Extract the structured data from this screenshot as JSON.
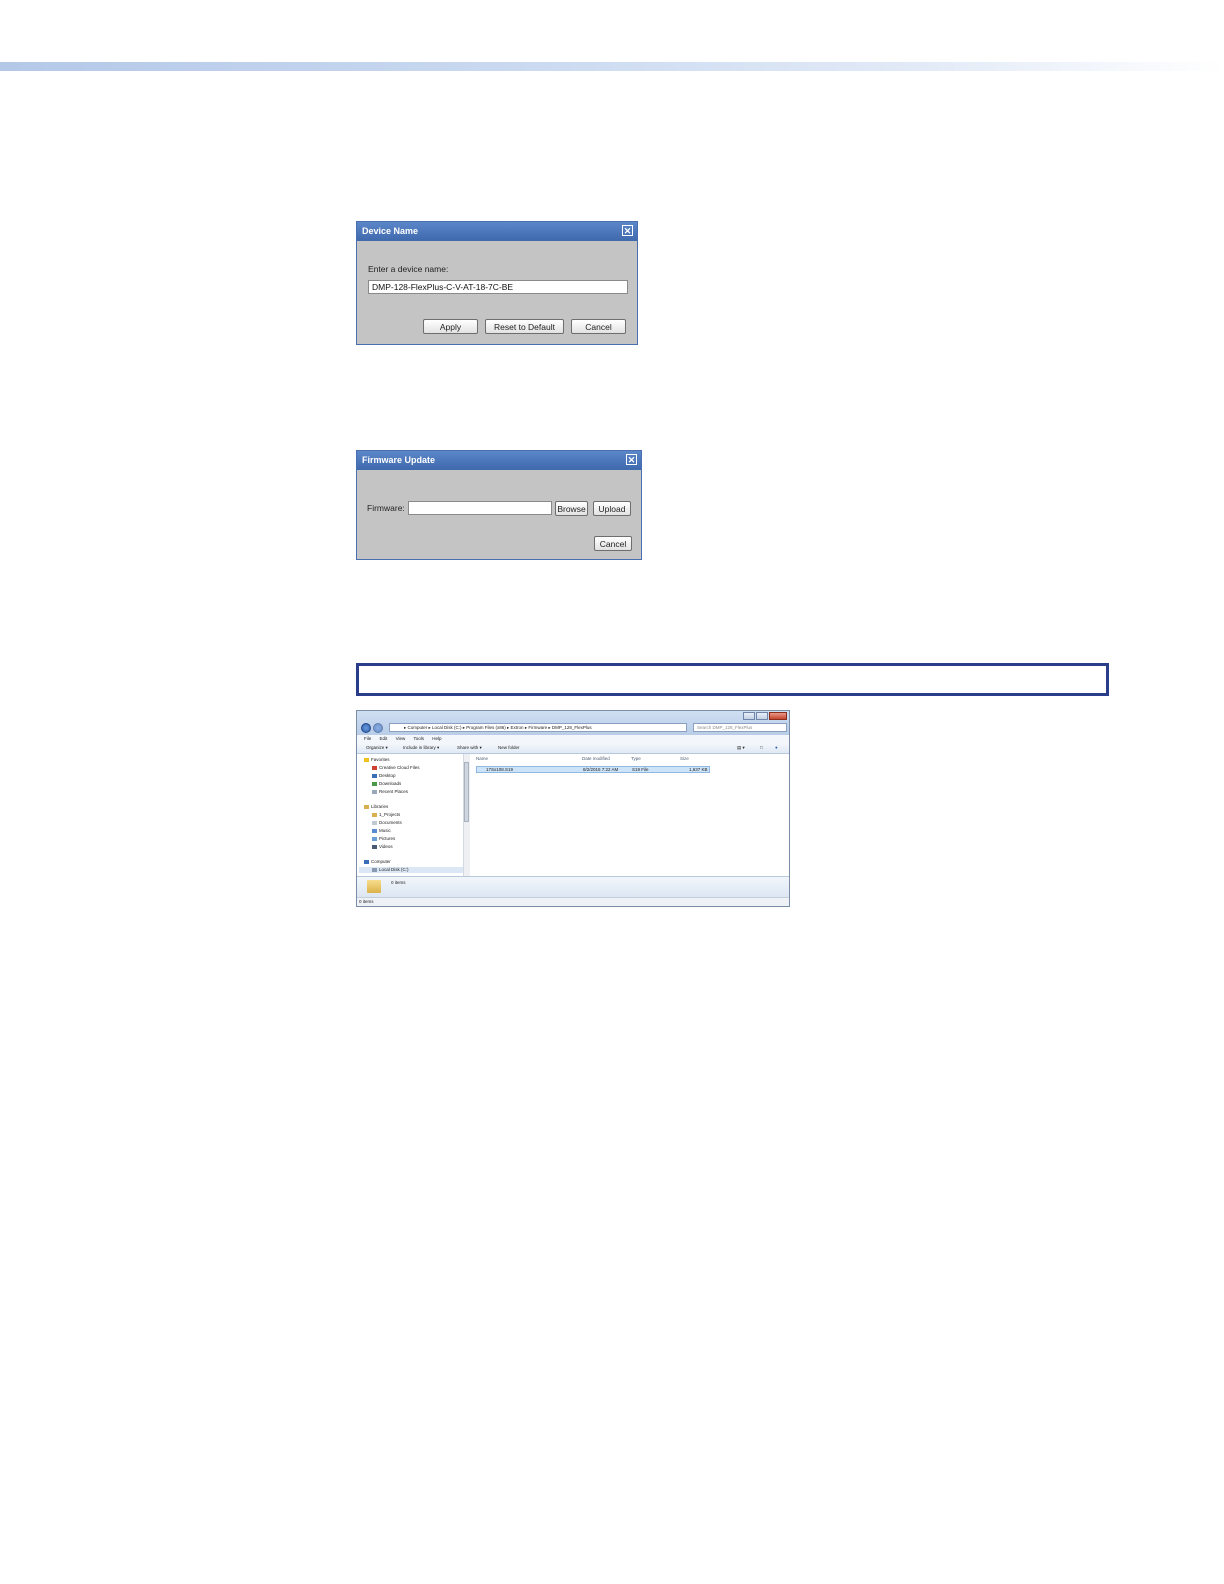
{
  "device_name_dialog": {
    "title": "Device Name",
    "prompt": "Enter a device name:",
    "value": "DMP-128-FlexPlus-C-V-AT-18-7C-BE",
    "apply_label": "Apply",
    "reset_label": "Reset to Default",
    "cancel_label": "Cancel",
    "close_glyph": "✕"
  },
  "firmware_dialog": {
    "title": "Firmware Update",
    "firmware_label": "Firmware:",
    "firmware_value": "",
    "browse_label": "Browse",
    "upload_label": "Upload",
    "cancel_label": "Cancel",
    "close_glyph": "✕"
  },
  "explorer": {
    "address": "▸ Computer ▸ Local Disk (C:) ▸ Program Files (x86) ▸ Extron ▸ Firmware ▸ DMP_128_FlexPlus",
    "search_placeholder": "Search DMP_128_FlexPlus",
    "menu": [
      "File",
      "Edit",
      "View",
      "Tools",
      "Help"
    ],
    "toolbar": {
      "organize": "Organize ▾",
      "include": "Include in library ▾",
      "share": "Share with ▾",
      "new_folder": "New folder"
    },
    "nav": {
      "favorites": "Favorites",
      "creative_cloud": "Creative Cloud Files",
      "desktop": "Desktop",
      "downloads": "Downloads",
      "recent": "Recent Places",
      "libraries": "Libraries",
      "projects": "1_Projects",
      "documents": "Documents",
      "music": "Music",
      "pictures": "Pictures",
      "videos": "Videos",
      "computer": "Computer",
      "local_disk": "Local Disk (C:)"
    },
    "columns": {
      "name": "Name",
      "date": "Date modified",
      "type": "Type",
      "size": "Size"
    },
    "file": {
      "name": "17Sx108.S19",
      "date": "8/2/2015 7:22 AM",
      "type": "S19 File",
      "size": "1,637 KB"
    },
    "details_text": "0 items",
    "status_text": "0 items"
  },
  "colors": {
    "dialog_bg": "#c4c4c4",
    "title_bar": "#4a74b8",
    "note_border": "#2a3d8a"
  }
}
